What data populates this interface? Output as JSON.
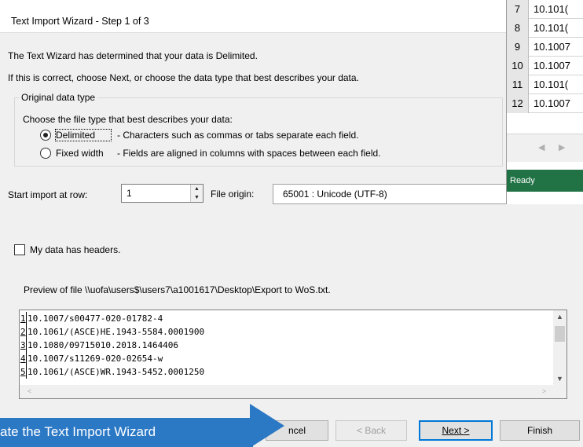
{
  "dialog": {
    "title": "Text Import Wizard - Step 1 of 3",
    "intro_line1": "The Text Wizard has determined that your data is Delimited.",
    "intro_line2": "If this is correct, choose Next, or choose the data type that best describes your data.",
    "group_title": "Original data type",
    "group_prompt": "Choose the file type that best describes your data:",
    "options": [
      {
        "label": "Delimited",
        "description": "- Characters such as commas or tabs separate each field.",
        "selected": true
      },
      {
        "label": "Fixed width",
        "description": "- Fields are aligned in columns with spaces between each field.",
        "selected": false
      }
    ],
    "start_row_label": "Start import at row:",
    "start_row_value": "1",
    "file_origin_label": "File origin:",
    "file_origin_value": "65001 : Unicode (UTF-8)",
    "headers_checkbox_label": "My data has headers.",
    "headers_checked": false,
    "preview_label": "Preview of file \\\\uofa\\users$\\users7\\a1001617\\Desktop\\Export to WoS.txt.",
    "preview_lines": [
      {
        "num": "1",
        "text": "10.1007/s00477-020-01782-4"
      },
      {
        "num": "2",
        "text": "10.1061/(ASCE)HE.1943-5584.0001900"
      },
      {
        "num": "3",
        "text": "10.1080/09715010.2018.1464406"
      },
      {
        "num": "4",
        "text": "10.1007/s11269-020-02654-w"
      },
      {
        "num": "5",
        "text": "10.1061/(ASCE)WR.1943-5452.0001250"
      }
    ],
    "buttons": {
      "cancel": "ncel",
      "back": "< Back",
      "next": "Next >",
      "finish": "Finish"
    }
  },
  "excel": {
    "rows": [
      {
        "num": "7",
        "value": "10.101("
      },
      {
        "num": "8",
        "value": "10.101("
      },
      {
        "num": "9",
        "value": "10.1007"
      },
      {
        "num": "10",
        "value": "10.1007"
      },
      {
        "num": "11",
        "value": "10.101("
      },
      {
        "num": "12",
        "value": "10.1007"
      }
    ],
    "status": "Ready"
  },
  "banner": {
    "text": "ate the Text Import Wizard",
    "color": "#2b78c5"
  }
}
